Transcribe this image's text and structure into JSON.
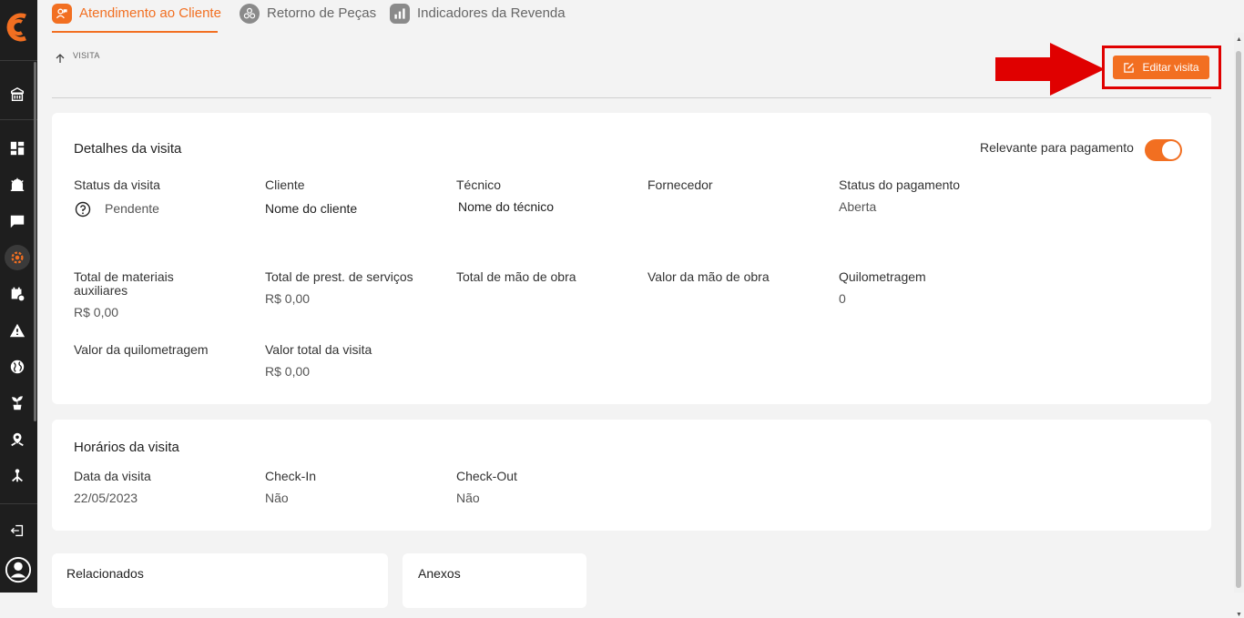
{
  "tabs": [
    {
      "label": "Atendimento ao Cliente",
      "active": true
    },
    {
      "label": "Retorno de Peças",
      "active": false
    },
    {
      "label": "Indicadores da Revenda",
      "active": false
    }
  ],
  "breadcrumb": {
    "label": "VISITA"
  },
  "toolbar": {
    "edit_label": "Editar visita"
  },
  "details": {
    "title": "Detalhes da visita",
    "relevant_label": "Relevante para pagamento",
    "relevant_on": true,
    "status_label": "Status da visita",
    "status_value": "Pendente",
    "client_label": "Cliente",
    "client_value": "Nome do cliente",
    "tech_label": "Técnico",
    "tech_value": "Nome do técnico",
    "supplier_label": "Fornecedor",
    "payment_status_label": "Status do pagamento",
    "payment_status_value": "Aberta",
    "materials_label_1": "Total de materiais",
    "materials_label_2": "auxiliares",
    "materials_value": "R$  0,00",
    "services_label": "Total de prest. de serviços",
    "services_value": "R$  0,00",
    "labor_total_label": "Total de mão de obra",
    "labor_value_label": "Valor da mão de obra",
    "mileage_label": "Quilometragem",
    "mileage_value": "0",
    "mileage_value_label": "Valor da quilometragem",
    "visit_total_label": "Valor total da visita",
    "visit_total_value": "R$  0,00"
  },
  "schedule": {
    "title": "Horários da visita",
    "date_label": "Data da visita",
    "date_value": "22/05/2023",
    "checkin_label": "Check-In",
    "checkin_value": "Não",
    "checkout_label": "Check-Out",
    "checkout_value": "Não"
  },
  "related": {
    "title": "Relacionados"
  },
  "attachments": {
    "title": "Anexos"
  },
  "colors": {
    "accent": "#f26f21",
    "sidebar": "#1e1e1e",
    "annotation": "#e00000"
  }
}
